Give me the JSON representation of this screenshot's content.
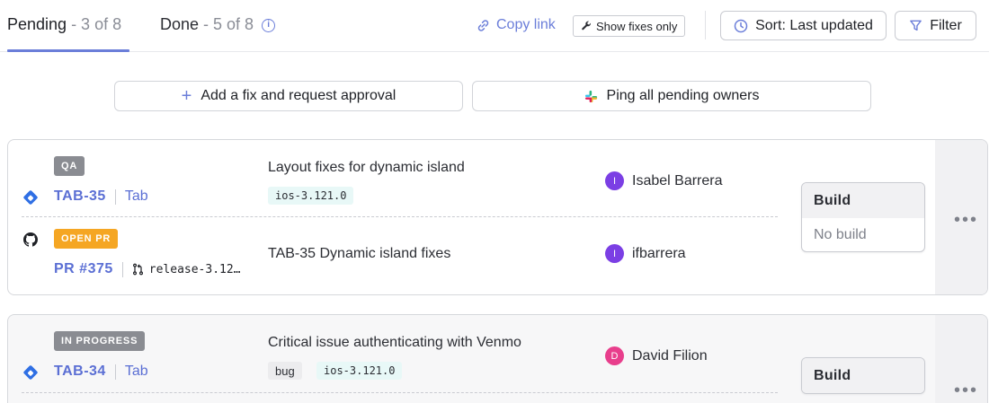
{
  "tabs": {
    "pending": {
      "label": "Pending",
      "count": " - 3 of 8"
    },
    "done": {
      "label": "Done",
      "count": " - 5 of 8"
    }
  },
  "toolbar": {
    "copy_link": "Copy link",
    "show_fixes_only": "Show fixes only",
    "sort": "Sort: Last updated",
    "filter": "Filter"
  },
  "actions": {
    "add_fix": "Add a fix and request approval",
    "ping_all": "Ping all pending owners"
  },
  "cards": [
    {
      "issue": {
        "status": "QA",
        "key": "TAB-35",
        "project": "Tab",
        "title": "Layout fixes for dynamic island",
        "tags": [
          "ios-3.121.0"
        ],
        "assignee": {
          "name": "Isabel Barrera",
          "initial": "I",
          "color": "#7b3fe4"
        }
      },
      "pr": {
        "status": "OPEN PR",
        "key": "PR #375",
        "branch": "release-3.12…",
        "title": "TAB-35 Dynamic island fixes",
        "author": {
          "name": "ifbarrera",
          "initial": "I",
          "color": "#7b3fe4"
        }
      },
      "build": {
        "label": "Build",
        "value": "No build"
      }
    },
    {
      "issue": {
        "status": "IN PROGRESS",
        "key": "TAB-34",
        "project": "Tab",
        "title": "Critical issue authenticating with Venmo",
        "tags": [
          "bug",
          "ios-3.121.0"
        ],
        "assignee": {
          "name": "David Filion",
          "initial": "D",
          "color": "#e83e8c"
        }
      },
      "build": {
        "label": "Build"
      }
    }
  ],
  "colors": {
    "accent": "#6b7ed9",
    "link": "#5b6fd4",
    "open_pr": "#f5a623",
    "status_gray": "#8a8c92"
  }
}
